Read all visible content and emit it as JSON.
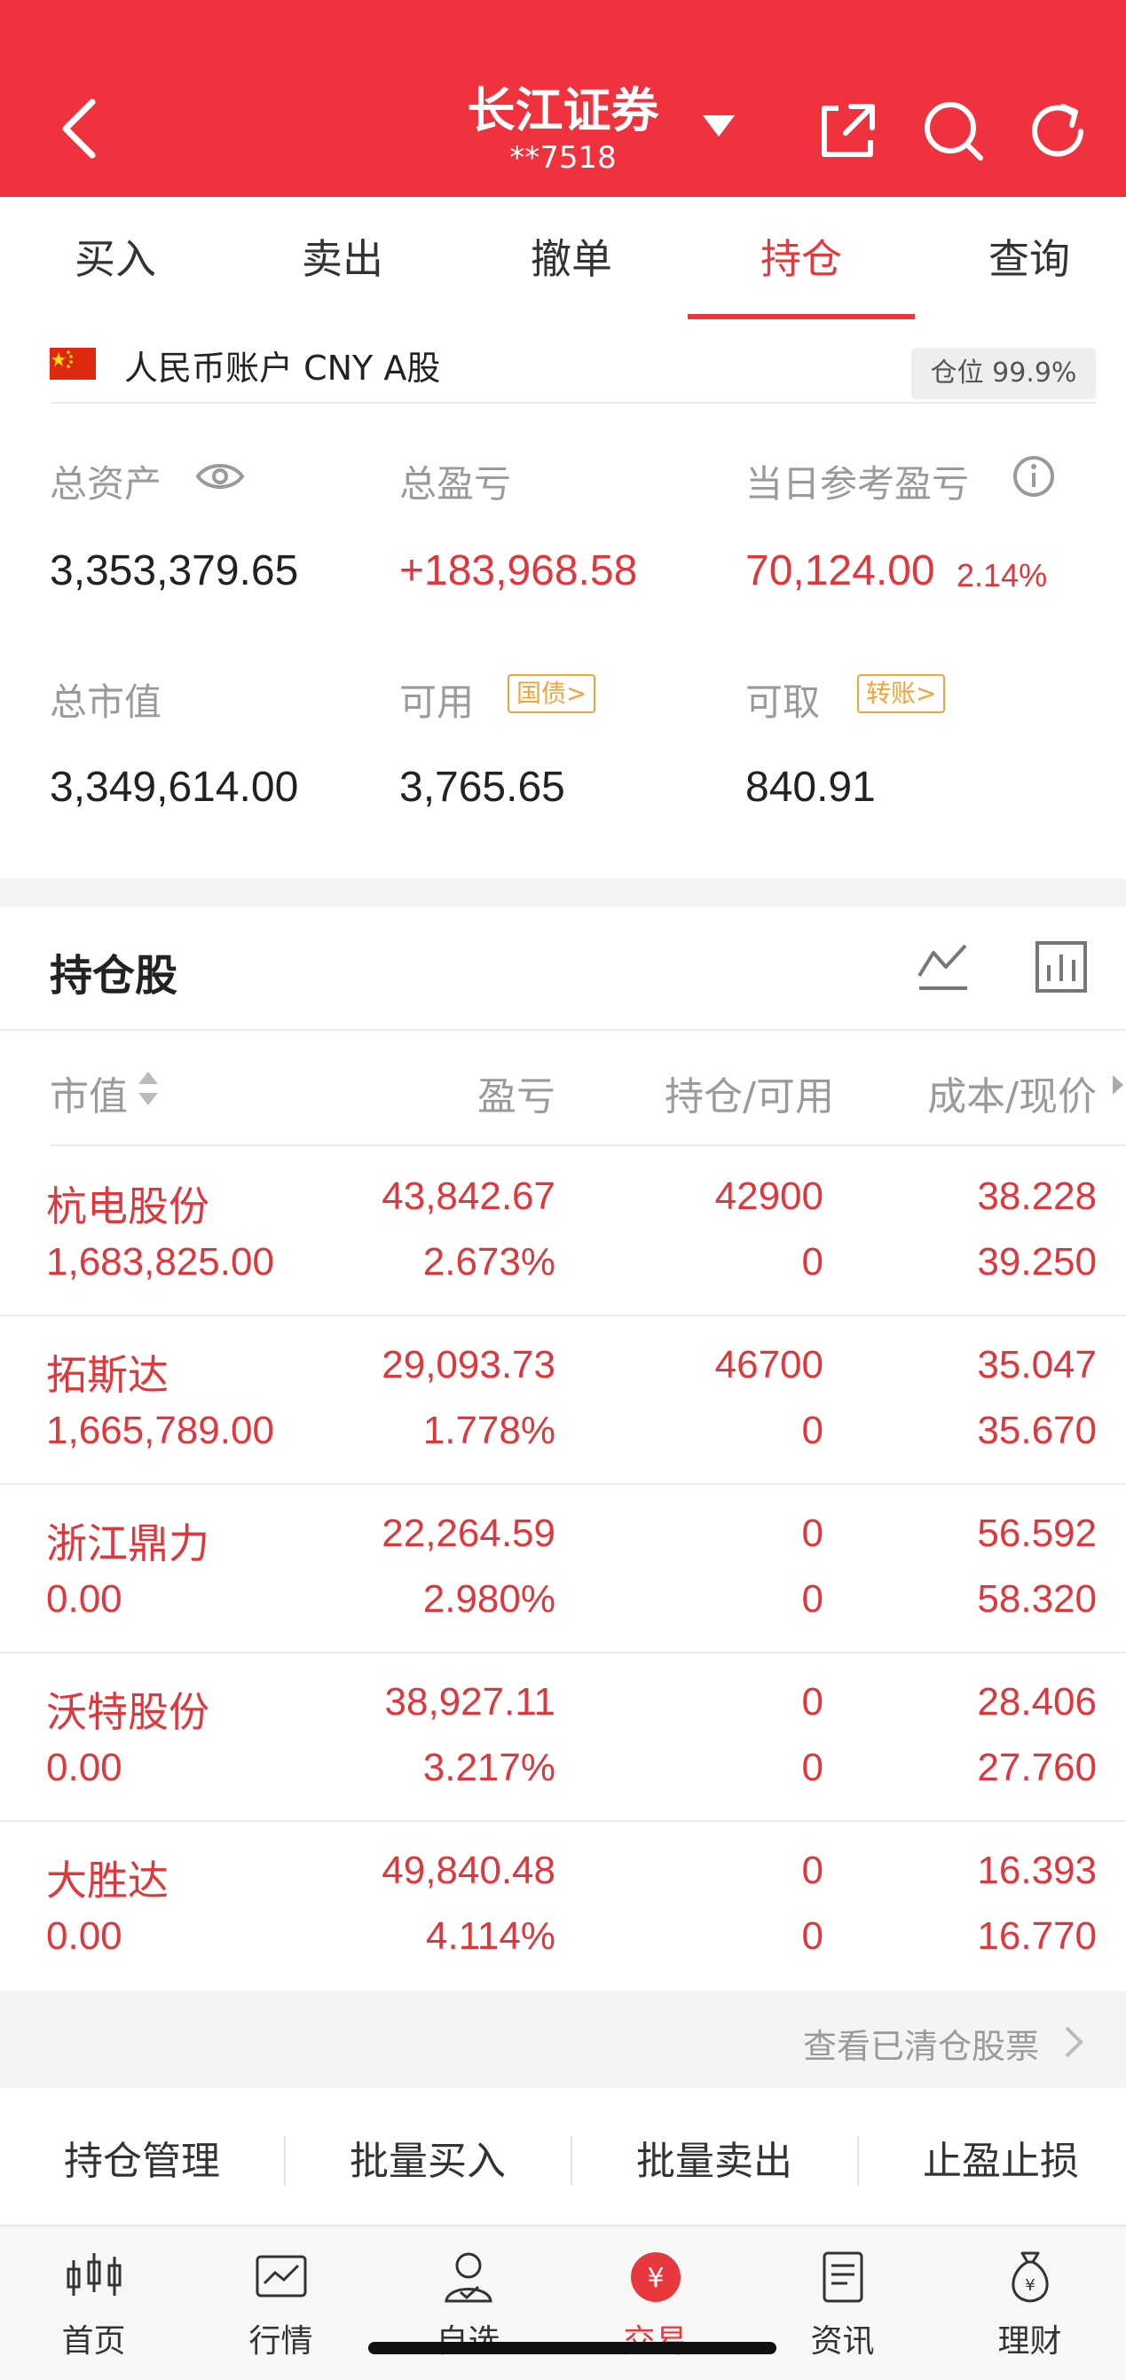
{
  "header": {
    "title": "长江证券",
    "account": "**7518",
    "bg_color": "#ef323d"
  },
  "tabs": [
    {
      "label": "买入"
    },
    {
      "label": "卖出"
    },
    {
      "label": "撤单"
    },
    {
      "label": "持仓",
      "active": true
    },
    {
      "label": "查询"
    }
  ],
  "account_row": {
    "label": "人民币账户 CNY A股",
    "position_badge": "仓位 99.9%"
  },
  "assets": {
    "total_assets_label": "总资产",
    "total_assets_value": "3,353,379.65",
    "total_pnl_label": "总盈亏",
    "total_pnl_value": "+183,968.58",
    "daily_pnl_label": "当日参考盈亏",
    "daily_pnl_value": "70,124.00",
    "daily_pnl_pct": "2.14%",
    "market_value_label": "总市值",
    "market_value_value": "3,349,614.00",
    "available_label": "可用",
    "available_tag": "国债>",
    "available_value": "3,765.65",
    "withdrawable_label": "可取",
    "withdrawable_tag": "转账>",
    "withdrawable_value": "840.91"
  },
  "holdings": {
    "title": "持仓股",
    "columns": [
      "市值",
      "盈亏",
      "持仓/可用",
      "成本/现价"
    ],
    "rows": [
      {
        "name": "杭电股份",
        "market_value": "1,683,825.00",
        "pnl": "43,842.67",
        "pnl_pct": "2.673%",
        "position": "42900",
        "available": "0",
        "cost": "38.228",
        "price": "39.250"
      },
      {
        "name": "拓斯达",
        "market_value": "1,665,789.00",
        "pnl": "29,093.73",
        "pnl_pct": "1.778%",
        "position": "46700",
        "available": "0",
        "cost": "35.047",
        "price": "35.670"
      },
      {
        "name": "浙江鼎力",
        "market_value": "0.00",
        "pnl": "22,264.59",
        "pnl_pct": "2.980%",
        "position": "0",
        "available": "0",
        "cost": "56.592",
        "price": "58.320"
      },
      {
        "name": "沃特股份",
        "market_value": "0.00",
        "pnl": "38,927.11",
        "pnl_pct": "3.217%",
        "position": "0",
        "available": "0",
        "cost": "28.406",
        "price": "27.760"
      },
      {
        "name": "大胜达",
        "market_value": "0.00",
        "pnl": "49,840.48",
        "pnl_pct": "4.114%",
        "position": "0",
        "available": "0",
        "cost": "16.393",
        "price": "16.770"
      }
    ],
    "cleared_link": "查看已清仓股票"
  },
  "actions": [
    "持仓管理",
    "批量买入",
    "批量卖出",
    "止盈止损"
  ],
  "bottom_nav": [
    {
      "label": "首页",
      "icon": "candlestick-icon"
    },
    {
      "label": "行情",
      "icon": "line-chart-icon"
    },
    {
      "label": "自选",
      "icon": "user-icon"
    },
    {
      "label": "交易",
      "icon": "yuan-icon",
      "active": true
    },
    {
      "label": "资讯",
      "icon": "document-icon"
    },
    {
      "label": "理财",
      "icon": "money-bag-icon"
    }
  ],
  "colors": {
    "accent": "#e8383d",
    "up": "#e0373c",
    "tag": "#f2a33a"
  }
}
